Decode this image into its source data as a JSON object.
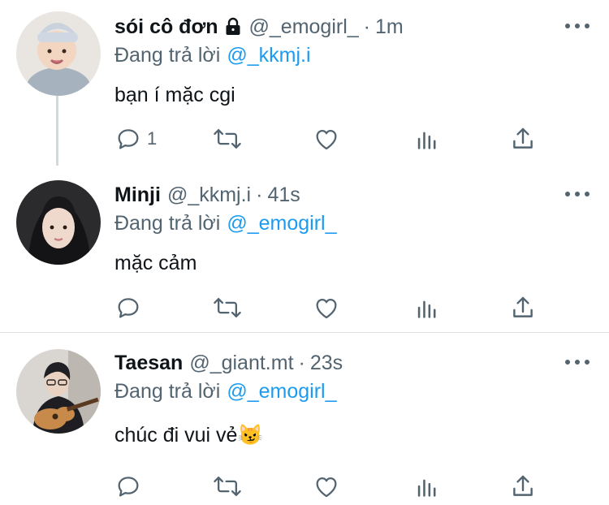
{
  "colors": {
    "accent": "#1d9bf0",
    "muted": "#536471",
    "text": "#0f1419"
  },
  "tweets": [
    {
      "name": "sói cô đơn",
      "locked": true,
      "handle": "@_emogirl_",
      "separator": "·",
      "time": "1m",
      "replying_prefix": "Đang trả lời",
      "replying_to": "@_kkmj.i",
      "text": "bạn í mặc cgi",
      "reply_count": "1",
      "avatar": "baby-photo"
    },
    {
      "name": "Minji",
      "locked": false,
      "handle": "@_kkmj.i",
      "separator": "·",
      "time": "41s",
      "replying_prefix": "Đang trả lời",
      "replying_to": "@_emogirl_",
      "text": "mặc cảm",
      "reply_count": "",
      "avatar": "girl-photo"
    },
    {
      "name": "Taesan",
      "locked": false,
      "handle": "@_giant.mt",
      "separator": "·",
      "time": "23s",
      "replying_prefix": "Đang trả lời",
      "replying_to": "@_emogirl_",
      "text": "chúc đi vui vẻ😼",
      "reply_count": "",
      "avatar": "guitar-player-photo"
    }
  ]
}
